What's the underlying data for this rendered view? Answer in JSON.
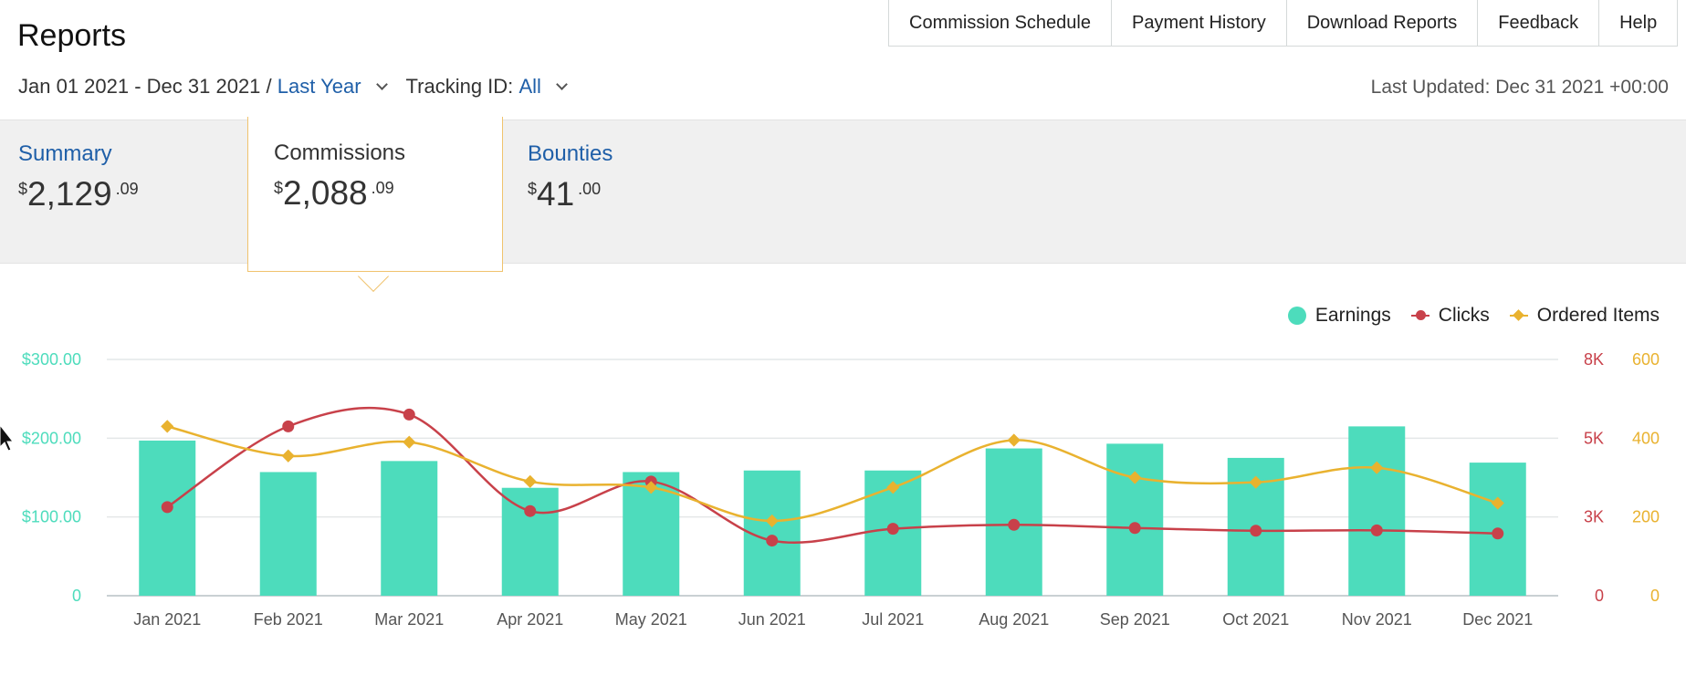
{
  "page": {
    "title": "Reports"
  },
  "top_tabs": [
    "Commission Schedule",
    "Payment History",
    "Download Reports",
    "Feedback",
    "Help"
  ],
  "filters": {
    "date_range": "Jan 01 2021 - Dec 31 2021 /",
    "preset": "Last Year",
    "tracking_label": "Tracking ID:",
    "tracking_value": "All"
  },
  "last_updated": "Last Updated: Dec 31 2021 +00:00",
  "summary_tabs": {
    "summary": {
      "label": "Summary",
      "symbol": "$",
      "whole": "2,129",
      "cents": ".09"
    },
    "commissions": {
      "label": "Commissions",
      "symbol": "$",
      "whole": "2,088",
      "cents": ".09"
    },
    "bounties": {
      "label": "Bounties",
      "symbol": "$",
      "whole": "41",
      "cents": ".00"
    }
  },
  "legend": {
    "earnings": "Earnings",
    "clicks": "Clicks",
    "ordered": "Ordered Items"
  },
  "colors": {
    "earnings": "#4ddcbc",
    "clicks": "#c8414a",
    "ordered": "#e9b22f",
    "link": "#1f5fa8",
    "active_border": "#f0c36d"
  },
  "chart_data": {
    "type": "bar",
    "categories": [
      "Jan 2021",
      "Feb 2021",
      "Mar 2021",
      "Apr 2021",
      "May 2021",
      "Jun 2021",
      "Jul 2021",
      "Aug 2021",
      "Sep 2021",
      "Oct 2021",
      "Nov 2021",
      "Dec 2021"
    ],
    "series": [
      {
        "name": "Earnings",
        "type": "bar",
        "axis": "left",
        "values": [
          197,
          157,
          171,
          137,
          157,
          159,
          159,
          187,
          193,
          175,
          215,
          169
        ]
      },
      {
        "name": "Clicks",
        "type": "line",
        "axis": "right1",
        "values": [
          2250,
          4300,
          4600,
          2150,
          2900,
          1400,
          1700,
          1800,
          1720,
          1650,
          1660,
          1580
        ]
      },
      {
        "name": "Ordered Items",
        "type": "line",
        "axis": "right2",
        "values": [
          430,
          355,
          390,
          290,
          275,
          190,
          275,
          395,
          300,
          288,
          325,
          235
        ]
      }
    ],
    "left_axis": {
      "ticks": [
        "$300.00",
        "$200.00",
        "$100.00",
        "0"
      ],
      "ylim": [
        0,
        300
      ]
    },
    "right_axis_1": {
      "ticks": [
        "8K",
        "5K",
        "3K",
        "0"
      ],
      "ylim": [
        0,
        6000
      ]
    },
    "right_axis_2": {
      "ticks": [
        "600",
        "400",
        "200",
        "0"
      ],
      "ylim": [
        0,
        600
      ]
    },
    "legend_position": "top-right",
    "grid": true
  }
}
